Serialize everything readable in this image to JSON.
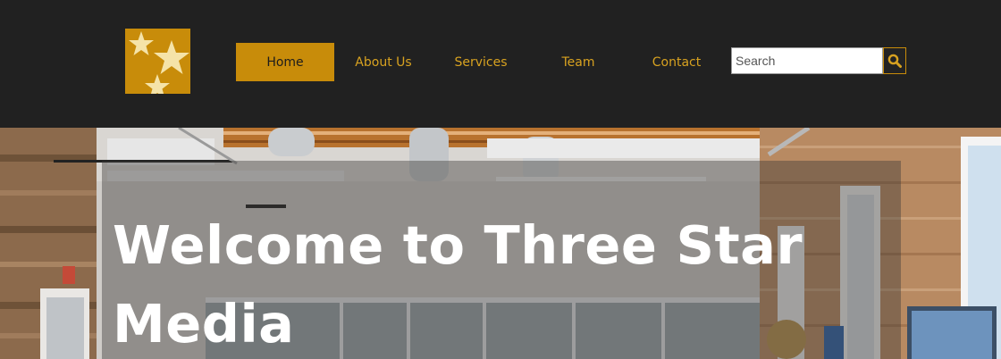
{
  "header": {
    "logo_icon": "three-stars-logo",
    "nav": [
      {
        "label": "Home",
        "active": true
      },
      {
        "label": "About Us",
        "active": false
      },
      {
        "label": "Services",
        "active": false
      },
      {
        "label": "Team",
        "active": false
      },
      {
        "label": "Contact",
        "active": false
      }
    ],
    "search": {
      "placeholder": "Search",
      "value": "",
      "button_icon": "magnifier-icon"
    }
  },
  "hero": {
    "title": "Welcome to Three Star Media",
    "background": "office-interior-photo"
  },
  "colors": {
    "header_bg": "#212121",
    "accent": "#c88c0a",
    "nav_text": "#d8a220",
    "hero_title": "#ffffff"
  }
}
